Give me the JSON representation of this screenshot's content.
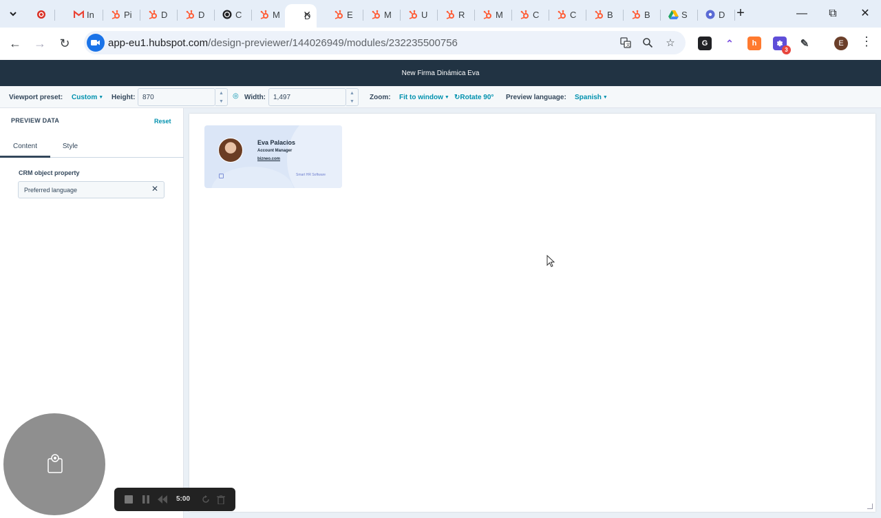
{
  "browser": {
    "tabs": [
      {
        "favicon": "target-icon",
        "title": "",
        "color": "#d93025"
      },
      {
        "favicon": "gmail-icon",
        "title": "In",
        "color": "#ea4335"
      },
      {
        "favicon": "hubspot-icon",
        "title": "Pi",
        "color": "#ff5c35"
      },
      {
        "favicon": "hubspot-icon",
        "title": "D",
        "color": "#ff5c35"
      },
      {
        "favicon": "hubspot-icon",
        "title": "D",
        "color": "#ff5c35"
      },
      {
        "favicon": "openai-icon",
        "title": "C",
        "color": "#202124"
      },
      {
        "favicon": "hubspot-icon",
        "title": "M",
        "color": "#ff5c35"
      },
      {
        "favicon": "",
        "title": "D",
        "color": "#202124",
        "active": true
      },
      {
        "favicon": "hubspot-icon",
        "title": "E",
        "color": "#ff5c35"
      },
      {
        "favicon": "hubspot-icon",
        "title": "M",
        "color": "#ff5c35"
      },
      {
        "favicon": "hubspot-icon",
        "title": "U",
        "color": "#ff5c35"
      },
      {
        "favicon": "hubspot-icon",
        "title": "R",
        "color": "#ff5c35"
      },
      {
        "favicon": "hubspot-icon",
        "title": "M",
        "color": "#ff5c35"
      },
      {
        "favicon": "hubspot-icon",
        "title": "C",
        "color": "#ff5c35"
      },
      {
        "favicon": "hubspot-icon",
        "title": "C",
        "color": "#ff5c35"
      },
      {
        "favicon": "hubspot-icon",
        "title": "B",
        "color": "#ff5c35"
      },
      {
        "favicon": "hubspot-icon",
        "title": "B",
        "color": "#ff5c35"
      },
      {
        "favicon": "drive-icon",
        "title": "S",
        "color": "#1fa463"
      },
      {
        "favicon": "gear-icon",
        "title": "D",
        "color": "#5b6bd5"
      }
    ],
    "url_host": "app-eu1.hubspot.com",
    "url_path": "/design-previewer/144026949/modules/232235500756",
    "profile_initial": "E",
    "extension_badge": "3"
  },
  "app": {
    "title": "New Firma Dinámica Eva"
  },
  "controls": {
    "viewport_label": "Viewport preset:",
    "viewport_value": "Custom",
    "height_label": "Height:",
    "height_value": "870",
    "width_label": "Width:",
    "width_value": "1,497",
    "zoom_label": "Zoom:",
    "zoom_value": "Fit to window",
    "rotate_label": "Rotate 90°",
    "language_label": "Preview language:",
    "language_value": "Spanish"
  },
  "sidebar": {
    "title": "PREVIEW DATA",
    "reset": "Reset",
    "tabs": [
      "Content",
      "Style"
    ],
    "field_label": "CRM object property",
    "field_value": "Preferred language"
  },
  "signature": {
    "name": "Eva Palacios",
    "role": "Account Manager",
    "link": "bizneo.com",
    "tagline": "Smart HR Software"
  },
  "recorder": {
    "time": "5:00"
  },
  "colors": {
    "hubspot_header": "#213343",
    "accent": "#0091ae",
    "hubspot_orange": "#ff5c35"
  }
}
